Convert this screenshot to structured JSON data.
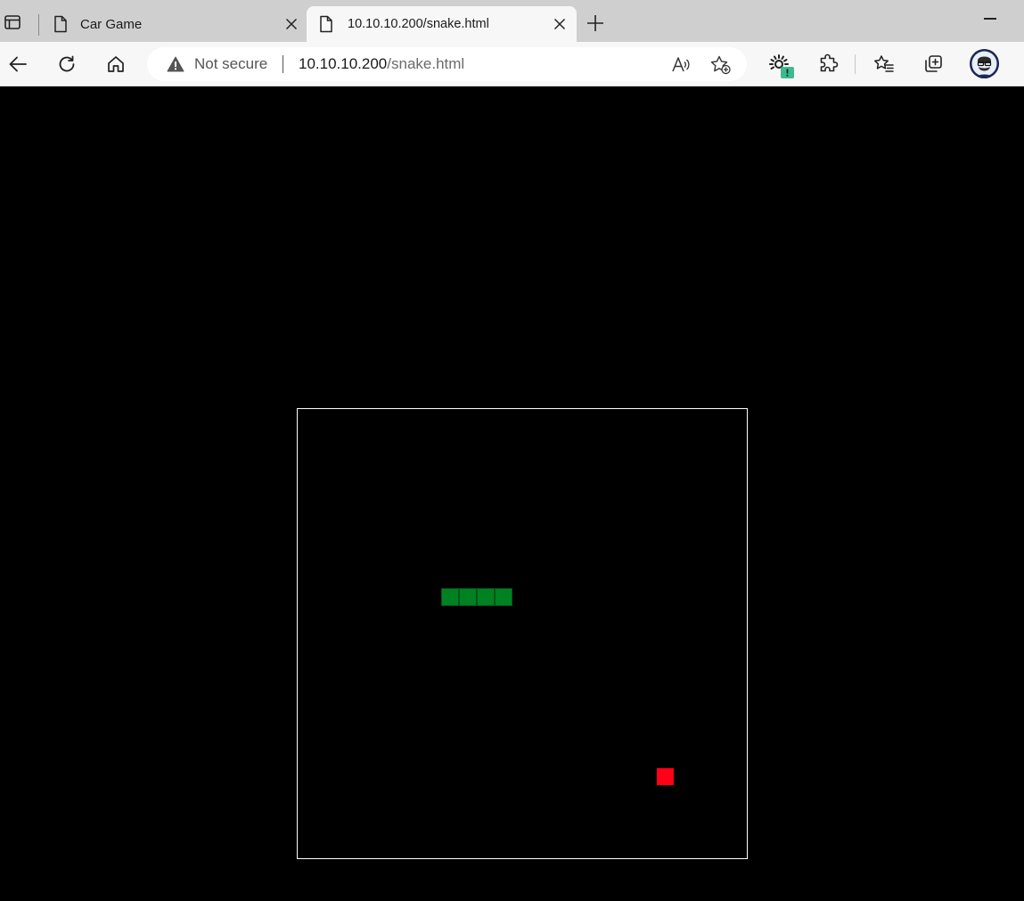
{
  "browser": {
    "tabs": [
      {
        "title": "Car Game",
        "active": false
      },
      {
        "title": "10.10.10.200/snake.html",
        "active": true
      }
    ],
    "address_bar": {
      "security_label": "Not secure",
      "url_host": "10.10.10.200",
      "url_path": "/snake.html"
    },
    "icons": {
      "tab_actions": "tab-actions-icon",
      "page": "page-icon",
      "close": "close-icon",
      "new_tab": "plus-icon",
      "back": "back-arrow-icon",
      "refresh": "refresh-icon",
      "home": "home-icon",
      "warning": "warning-icon",
      "read_aloud": "read-aloud-icon",
      "add_favorite": "add-favorite-icon",
      "extension_alert": "extension-alert-icon",
      "extensions": "puzzle-icon",
      "favorites": "favorites-icon",
      "collections": "collections-icon",
      "profile": "profile-avatar"
    }
  },
  "game": {
    "board_cells": 25,
    "snake_color": "#008223",
    "food_color": "#ff0016",
    "snake": [
      {
        "col": 8,
        "row": 10
      },
      {
        "col": 9,
        "row": 10
      },
      {
        "col": 10,
        "row": 10
      },
      {
        "col": 11,
        "row": 10
      }
    ],
    "food": {
      "col": 20,
      "row": 20
    }
  }
}
